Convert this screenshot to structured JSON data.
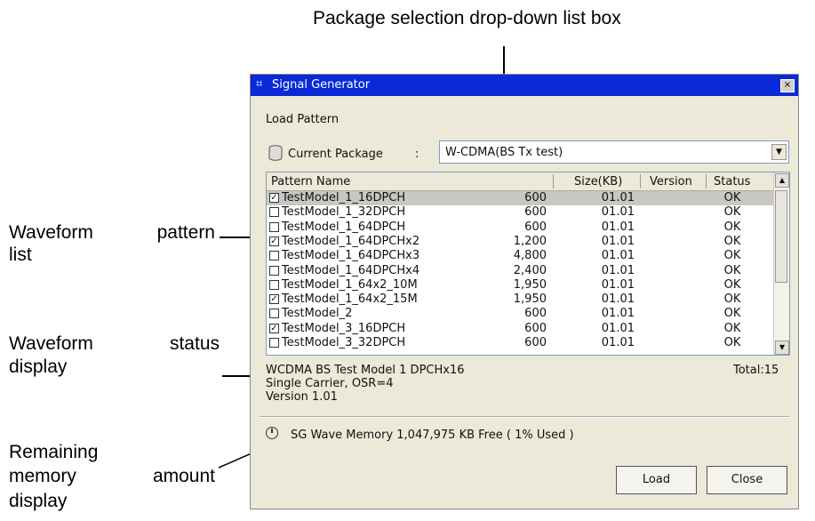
{
  "annotations": {
    "package_dropdown": "Package selection drop-down list box",
    "pattern_list": [
      "Waveform pattern",
      "list"
    ],
    "status_display": [
      "Waveform status",
      "display"
    ],
    "memory_display": [
      "Remaining",
      "memory amount",
      "display"
    ]
  },
  "window": {
    "title": "Signal Generator",
    "close_glyph": "×",
    "section_label": "Load Pattern",
    "current_package_label": "Current Package",
    "colon": ":",
    "current_package_value": "W-CDMA(BS Tx test)",
    "dropdown_glyph": "▼",
    "columns": {
      "name": "Pattern Name",
      "size": "Size(KB)",
      "version": "Version",
      "status": "Status"
    },
    "checked_glyph": "✓",
    "rows": [
      {
        "name": "TestModel_1_16DPCH",
        "size": "600",
        "version": "01.01",
        "status": "OK",
        "checked": true
      },
      {
        "name": "TestModel_1_32DPCH",
        "size": "600",
        "version": "01.01",
        "status": "OK",
        "checked": false
      },
      {
        "name": "TestModel_1_64DPCH",
        "size": "600",
        "version": "01.01",
        "status": "OK",
        "checked": false
      },
      {
        "name": "TestModel_1_64DPCHx2",
        "size": "1,200",
        "version": "01.01",
        "status": "OK",
        "checked": true
      },
      {
        "name": "TestModel_1_64DPCHx3",
        "size": "4,800",
        "version": "01.01",
        "status": "OK",
        "checked": false
      },
      {
        "name": "TestModel_1_64DPCHx4",
        "size": "2,400",
        "version": "01.01",
        "status": "OK",
        "checked": false
      },
      {
        "name": "TestModel_1_64x2_10M",
        "size": "1,950",
        "version": "01.01",
        "status": "OK",
        "checked": false
      },
      {
        "name": "TestModel_1_64x2_15M",
        "size": "1,950",
        "version": "01.01",
        "status": "OK",
        "checked": true
      },
      {
        "name": "TestModel_2",
        "size": "600",
        "version": "01.01",
        "status": "OK",
        "checked": false
      },
      {
        "name": "TestModel_3_16DPCH",
        "size": "600",
        "version": "01.01",
        "status": "OK",
        "checked": true
      },
      {
        "name": "TestModel_3_32DPCH",
        "size": "600",
        "version": "01.01",
        "status": "OK",
        "checked": false
      }
    ],
    "status_lines": [
      "WCDMA BS Test Model 1 DPCHx16",
      "Single Carrier, OSR=4",
      "Version 1.01"
    ],
    "total": "Total:15",
    "memory_text": "SG Wave Memory 1,047,975 KB Free ( 1% Used )",
    "load_button": "Load",
    "close_button": "Close",
    "scroll_up_glyph": "▲",
    "scroll_down_glyph": "▼"
  }
}
